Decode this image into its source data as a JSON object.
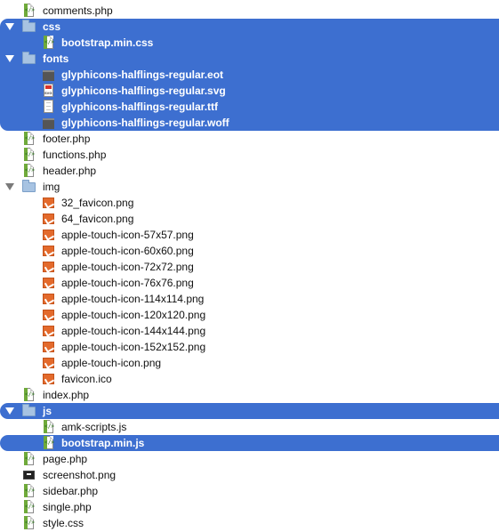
{
  "tree": {
    "items": [
      {
        "label": "comments.php",
        "icon": "php-file-icon",
        "level": 0
      },
      {
        "label": "css",
        "icon": "folder-icon",
        "level": 0,
        "expanded": true,
        "selected": true
      },
      {
        "label": "bootstrap.min.css",
        "icon": "css-file-icon",
        "level": 1,
        "selected": true
      },
      {
        "label": "fonts",
        "icon": "folder-icon",
        "level": 0,
        "expanded": true,
        "selected": true
      },
      {
        "label": "glyphicons-halflings-regular.eot",
        "icon": "font-file-icon",
        "level": 1,
        "selected": true
      },
      {
        "label": "glyphicons-halflings-regular.svg",
        "icon": "svg-file-icon",
        "level": 1,
        "selected": true
      },
      {
        "label": "glyphicons-halflings-regular.ttf",
        "icon": "ttf-file-icon",
        "level": 1,
        "selected": true
      },
      {
        "label": "glyphicons-halflings-regular.woff",
        "icon": "font-file-icon",
        "level": 1,
        "selected": true
      },
      {
        "label": "footer.php",
        "icon": "php-file-icon",
        "level": 0
      },
      {
        "label": "functions.php",
        "icon": "php-file-icon",
        "level": 0
      },
      {
        "label": "header.php",
        "icon": "php-file-icon",
        "level": 0
      },
      {
        "label": "img",
        "icon": "folder-icon",
        "level": 0,
        "expanded": true
      },
      {
        "label": "32_favicon.png",
        "icon": "png-file-icon",
        "level": 1
      },
      {
        "label": "64_favicon.png",
        "icon": "png-file-icon",
        "level": 1
      },
      {
        "label": "apple-touch-icon-57x57.png",
        "icon": "png-file-icon",
        "level": 1
      },
      {
        "label": "apple-touch-icon-60x60.png",
        "icon": "png-file-icon",
        "level": 1
      },
      {
        "label": "apple-touch-icon-72x72.png",
        "icon": "png-file-icon",
        "level": 1
      },
      {
        "label": "apple-touch-icon-76x76.png",
        "icon": "png-file-icon",
        "level": 1
      },
      {
        "label": "apple-touch-icon-114x114.png",
        "icon": "png-file-icon",
        "level": 1
      },
      {
        "label": "apple-touch-icon-120x120.png",
        "icon": "png-file-icon",
        "level": 1
      },
      {
        "label": "apple-touch-icon-144x144.png",
        "icon": "png-file-icon",
        "level": 1
      },
      {
        "label": "apple-touch-icon-152x152.png",
        "icon": "png-file-icon",
        "level": 1
      },
      {
        "label": "apple-touch-icon.png",
        "icon": "png-file-icon",
        "level": 1
      },
      {
        "label": "favicon.ico",
        "icon": "ico-file-icon",
        "level": 1
      },
      {
        "label": "index.php",
        "icon": "php-file-icon",
        "level": 0
      },
      {
        "label": "js",
        "icon": "folder-icon",
        "level": 0,
        "expanded": true,
        "selected": true
      },
      {
        "label": "amk-scripts.js",
        "icon": "js-file-icon",
        "level": 1
      },
      {
        "label": "bootstrap.min.js",
        "icon": "js-file-icon",
        "level": 1,
        "selected": true
      },
      {
        "label": "page.php",
        "icon": "php-file-icon",
        "level": 0
      },
      {
        "label": "screenshot.png",
        "icon": "screenshot-file-icon",
        "level": 0
      },
      {
        "label": "sidebar.php",
        "icon": "php-file-icon",
        "level": 0
      },
      {
        "label": "single.php",
        "icon": "php-file-icon",
        "level": 0
      },
      {
        "label": "style.css",
        "icon": "css-file-icon",
        "level": 0
      }
    ]
  },
  "colors": {
    "selection": "#3d6fd0",
    "selection_text": "#ffffff",
    "folder": "#a7c3e2",
    "image_file": "#e36a2c"
  }
}
